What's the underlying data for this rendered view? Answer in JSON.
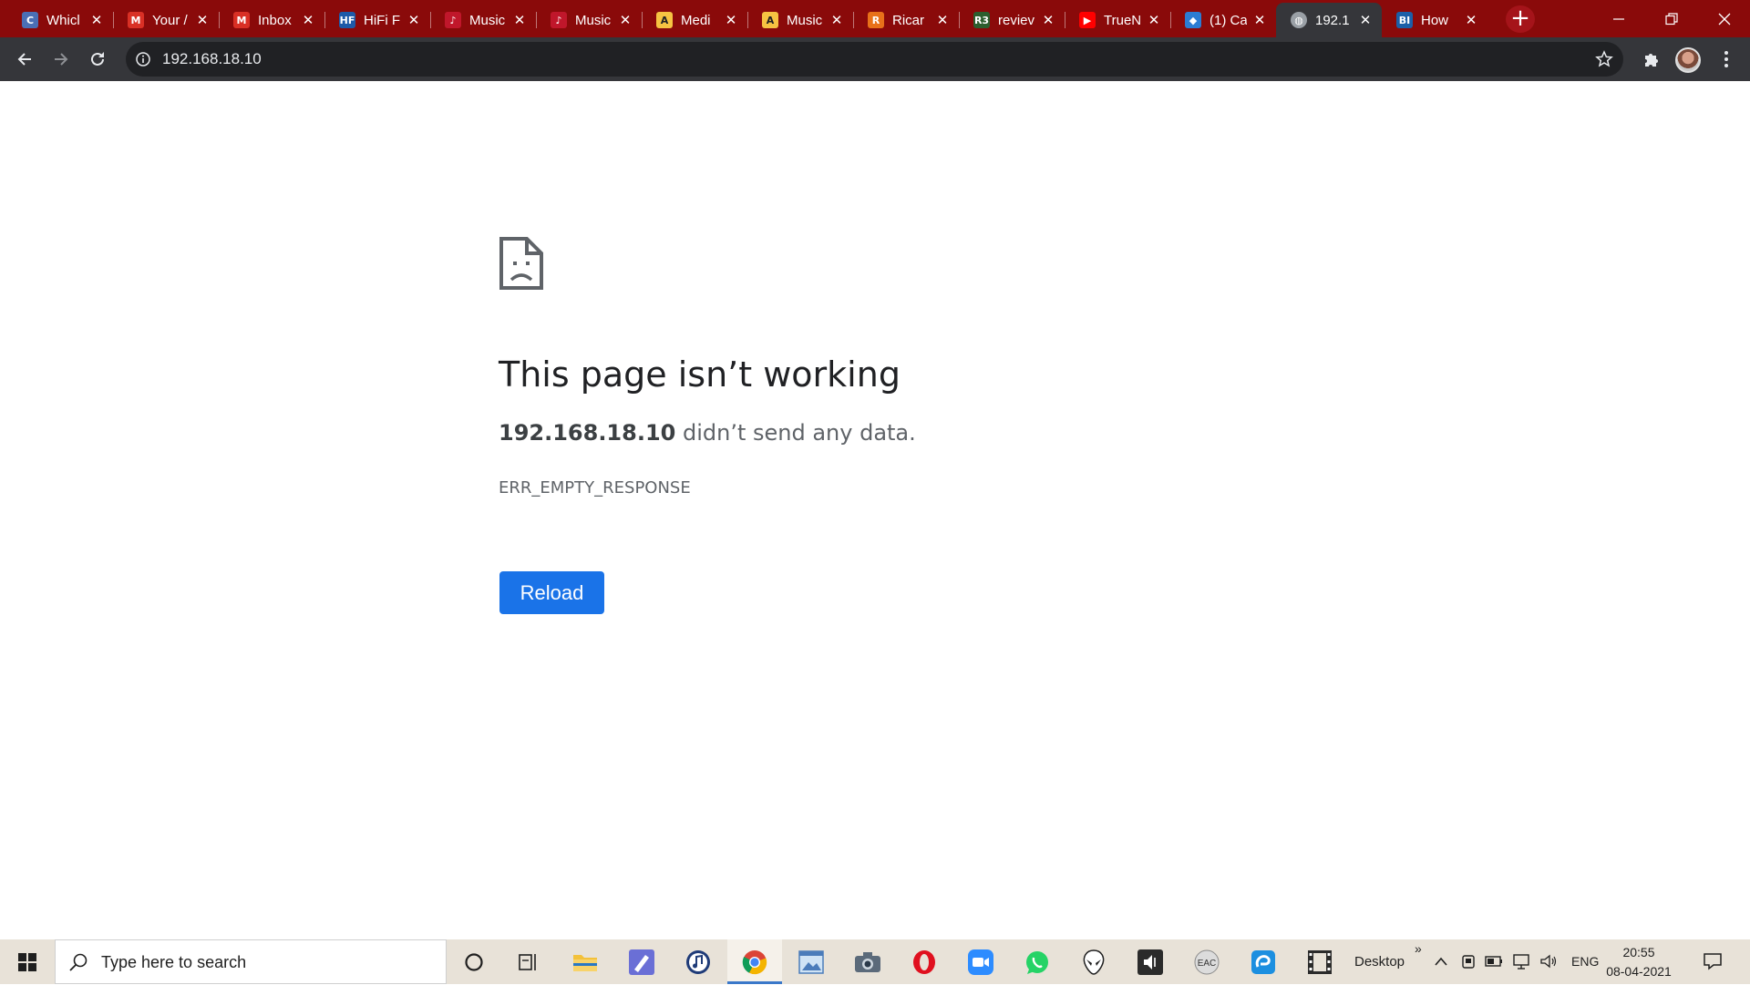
{
  "tabs": [
    {
      "title": "Whicl",
      "icon": "chrome-web-icon",
      "color": "#4a6fb5",
      "glyph": "C"
    },
    {
      "title": "Your /",
      "icon": "gmail-icon",
      "color": "#d93025",
      "glyph": "M"
    },
    {
      "title": "Inbox",
      "icon": "gmail-icon",
      "color": "#d93025",
      "glyph": "M"
    },
    {
      "title": "HiFi F",
      "icon": "hifi-icon",
      "color": "#1e5aa8",
      "glyph": "HF"
    },
    {
      "title": "Music",
      "icon": "music-app-icon",
      "color": "#c0172b",
      "glyph": "♪"
    },
    {
      "title": "Music",
      "icon": "music-app-icon",
      "color": "#c0172b",
      "glyph": "♪"
    },
    {
      "title": "Medi",
      "icon": "a-letter-icon",
      "color": "#f6c342",
      "glyph": "A"
    },
    {
      "title": "Music",
      "icon": "a-letter-icon",
      "color": "#f6c342",
      "glyph": "A"
    },
    {
      "title": "Ricar",
      "icon": "r-letter-icon",
      "color": "#e8711a",
      "glyph": "R"
    },
    {
      "title": "reviev",
      "icon": "r33-icon",
      "color": "#2c5e2e",
      "glyph": "R3"
    },
    {
      "title": "TrueN",
      "icon": "youtube-icon",
      "color": "#ff0000",
      "glyph": "▶"
    },
    {
      "title": "(1) Ca",
      "icon": "diamond-icon",
      "color": "#2b7cd3",
      "glyph": "◆"
    },
    {
      "title": "192.1",
      "icon": "globe-icon",
      "color": "#5f6368",
      "glyph": "◍",
      "active": true
    },
    {
      "title": "How",
      "icon": "bi-icon",
      "color": "#1b5fa8",
      "glyph": "BI"
    }
  ],
  "toolbar": {
    "url": "192.168.18.10"
  },
  "error": {
    "title": "This page isn’t working",
    "host": "192.168.18.10",
    "message": " didn’t send any data.",
    "code": "ERR_EMPTY_RESPONSE",
    "reload_label": "Reload"
  },
  "taskbar": {
    "search_placeholder": "Type here to search",
    "desktop_label": "Desktop",
    "overflow": "»",
    "language": "ENG",
    "time": "20:55",
    "date": "08-04-2021"
  },
  "colors": {
    "tabstrip": "#8a0a0a",
    "toolbar": "#35363a",
    "accent": "#1a73e8"
  }
}
